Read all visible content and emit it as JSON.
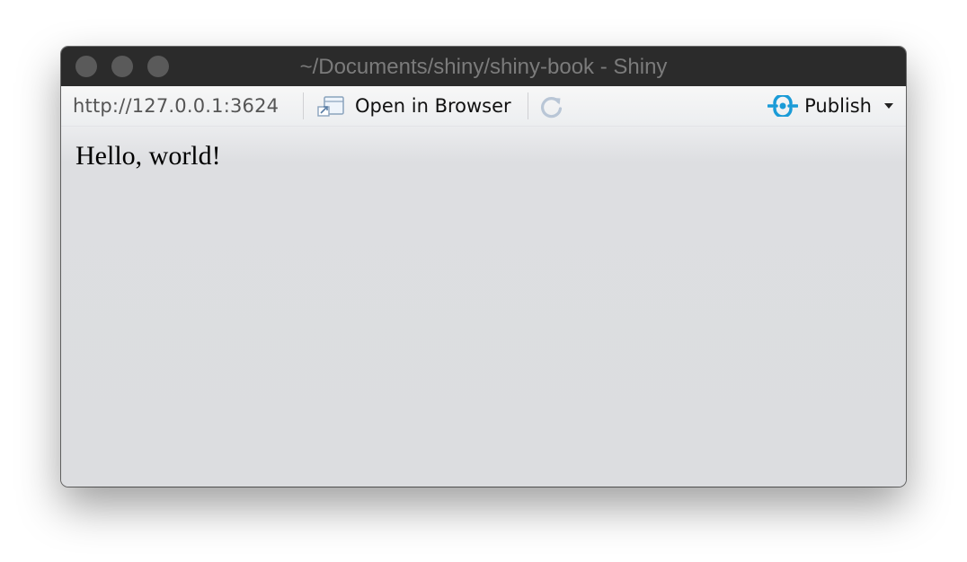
{
  "window": {
    "title": "~/Documents/shiny/shiny-book - Shiny"
  },
  "toolbar": {
    "url": "http://127.0.0.1:3624",
    "open_in_browser_label": "Open in Browser",
    "publish_label": "Publish",
    "icons": {
      "open_in_browser": "open-in-browser-icon",
      "refresh": "refresh-icon",
      "publish": "publish-icon",
      "dropdown": "chevron-down-icon"
    },
    "colors": {
      "publish_accent": "#1a9bd7"
    }
  },
  "content": {
    "heading": "Hello, world!"
  }
}
